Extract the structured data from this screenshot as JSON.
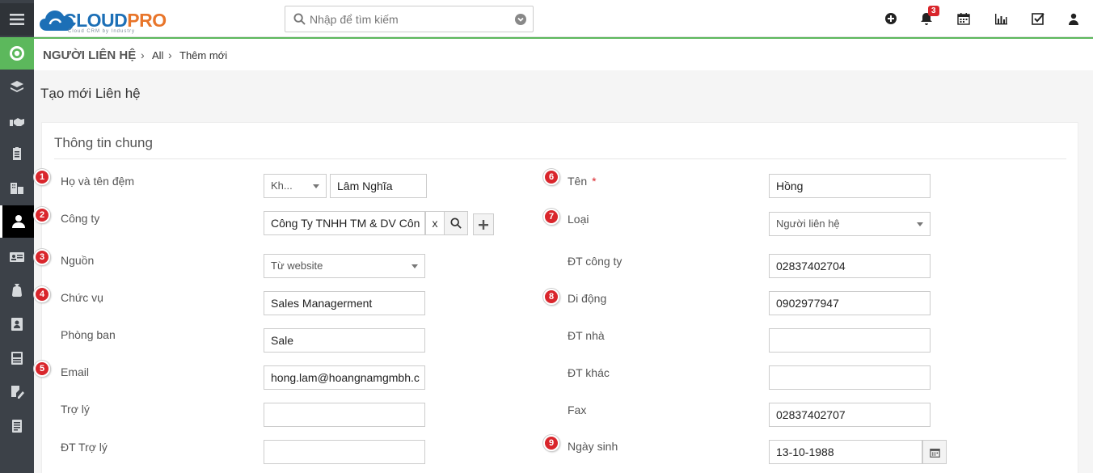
{
  "app": {
    "logo_cloud": "CLOUD",
    "logo_pro": "PRO",
    "logo_sub": "Cloud CRM by Industry"
  },
  "search": {
    "placeholder": "Nhập để tìm kiếm"
  },
  "header": {
    "notification_count": "3"
  },
  "breadcrumb": {
    "module": "NGƯỜI LIÊN HỆ",
    "sep": "›",
    "level1": "All",
    "level2": "Thêm mới"
  },
  "page": {
    "title": "Tạo mới Liên hệ"
  },
  "section": {
    "title": "Thông tin chung"
  },
  "form": {
    "left": {
      "ho_ten_dem": {
        "num": "1",
        "label": "Họ và tên đệm",
        "salutation": "Kh...",
        "value": "Lâm Nghĩa"
      },
      "cong_ty": {
        "num": "2",
        "label": "Công ty",
        "value": "Công Ty TNHH TM & DV Côn",
        "clear": "x"
      },
      "nguon": {
        "num": "3",
        "label": "Nguồn",
        "value": "Từ website"
      },
      "chuc_vu": {
        "num": "4",
        "label": "Chức vụ",
        "value": "Sales Managerment"
      },
      "phong_ban": {
        "label": "Phòng ban",
        "value": "Sale"
      },
      "email": {
        "num": "5",
        "label": "Email",
        "value": "hong.lam@hoangnamgmbh.c"
      },
      "tro_ly": {
        "label": "Trợ lý",
        "value": ""
      },
      "dt_tro_ly": {
        "label": "ĐT Trợ lý",
        "value": ""
      }
    },
    "right": {
      "ten": {
        "num": "6",
        "label": "Tên",
        "required": "*",
        "value": "Hồng"
      },
      "loai": {
        "num": "7",
        "label": "Loại",
        "value": "Người liên hệ"
      },
      "dt_cong_ty": {
        "label": "ĐT công ty",
        "value": "02837402704"
      },
      "di_dong": {
        "num": "8",
        "label": "Di động",
        "value": "0902977947"
      },
      "dt_nha": {
        "label": "ĐT nhà",
        "value": ""
      },
      "dt_khac": {
        "label": "ĐT khác",
        "value": ""
      },
      "fax": {
        "label": "Fax",
        "value": "02837402707"
      },
      "ngay_sinh": {
        "num": "9",
        "label": "Ngày sinh",
        "value": "13-10-1988"
      }
    }
  },
  "colors": {
    "accent_green": "#5cb85c",
    "sidebar": "#3c4148",
    "badge_red": "#d9262c",
    "brand_blue": "#1c6fb6",
    "brand_orange": "#e8752a"
  },
  "icons": {
    "sidebar": [
      "menu-icon",
      "dashboard-icon",
      "layers-icon",
      "handshake-icon",
      "clipboard-icon",
      "building-icon",
      "person-icon",
      "id-card-icon",
      "money-bag-icon",
      "contact-book-icon",
      "sales-order-icon",
      "edit-document-icon",
      "report-icon"
    ],
    "header": [
      "add-circle-icon",
      "bell-icon",
      "calendar-icon",
      "chart-icon",
      "checkbox-icon",
      "user-icon"
    ]
  }
}
